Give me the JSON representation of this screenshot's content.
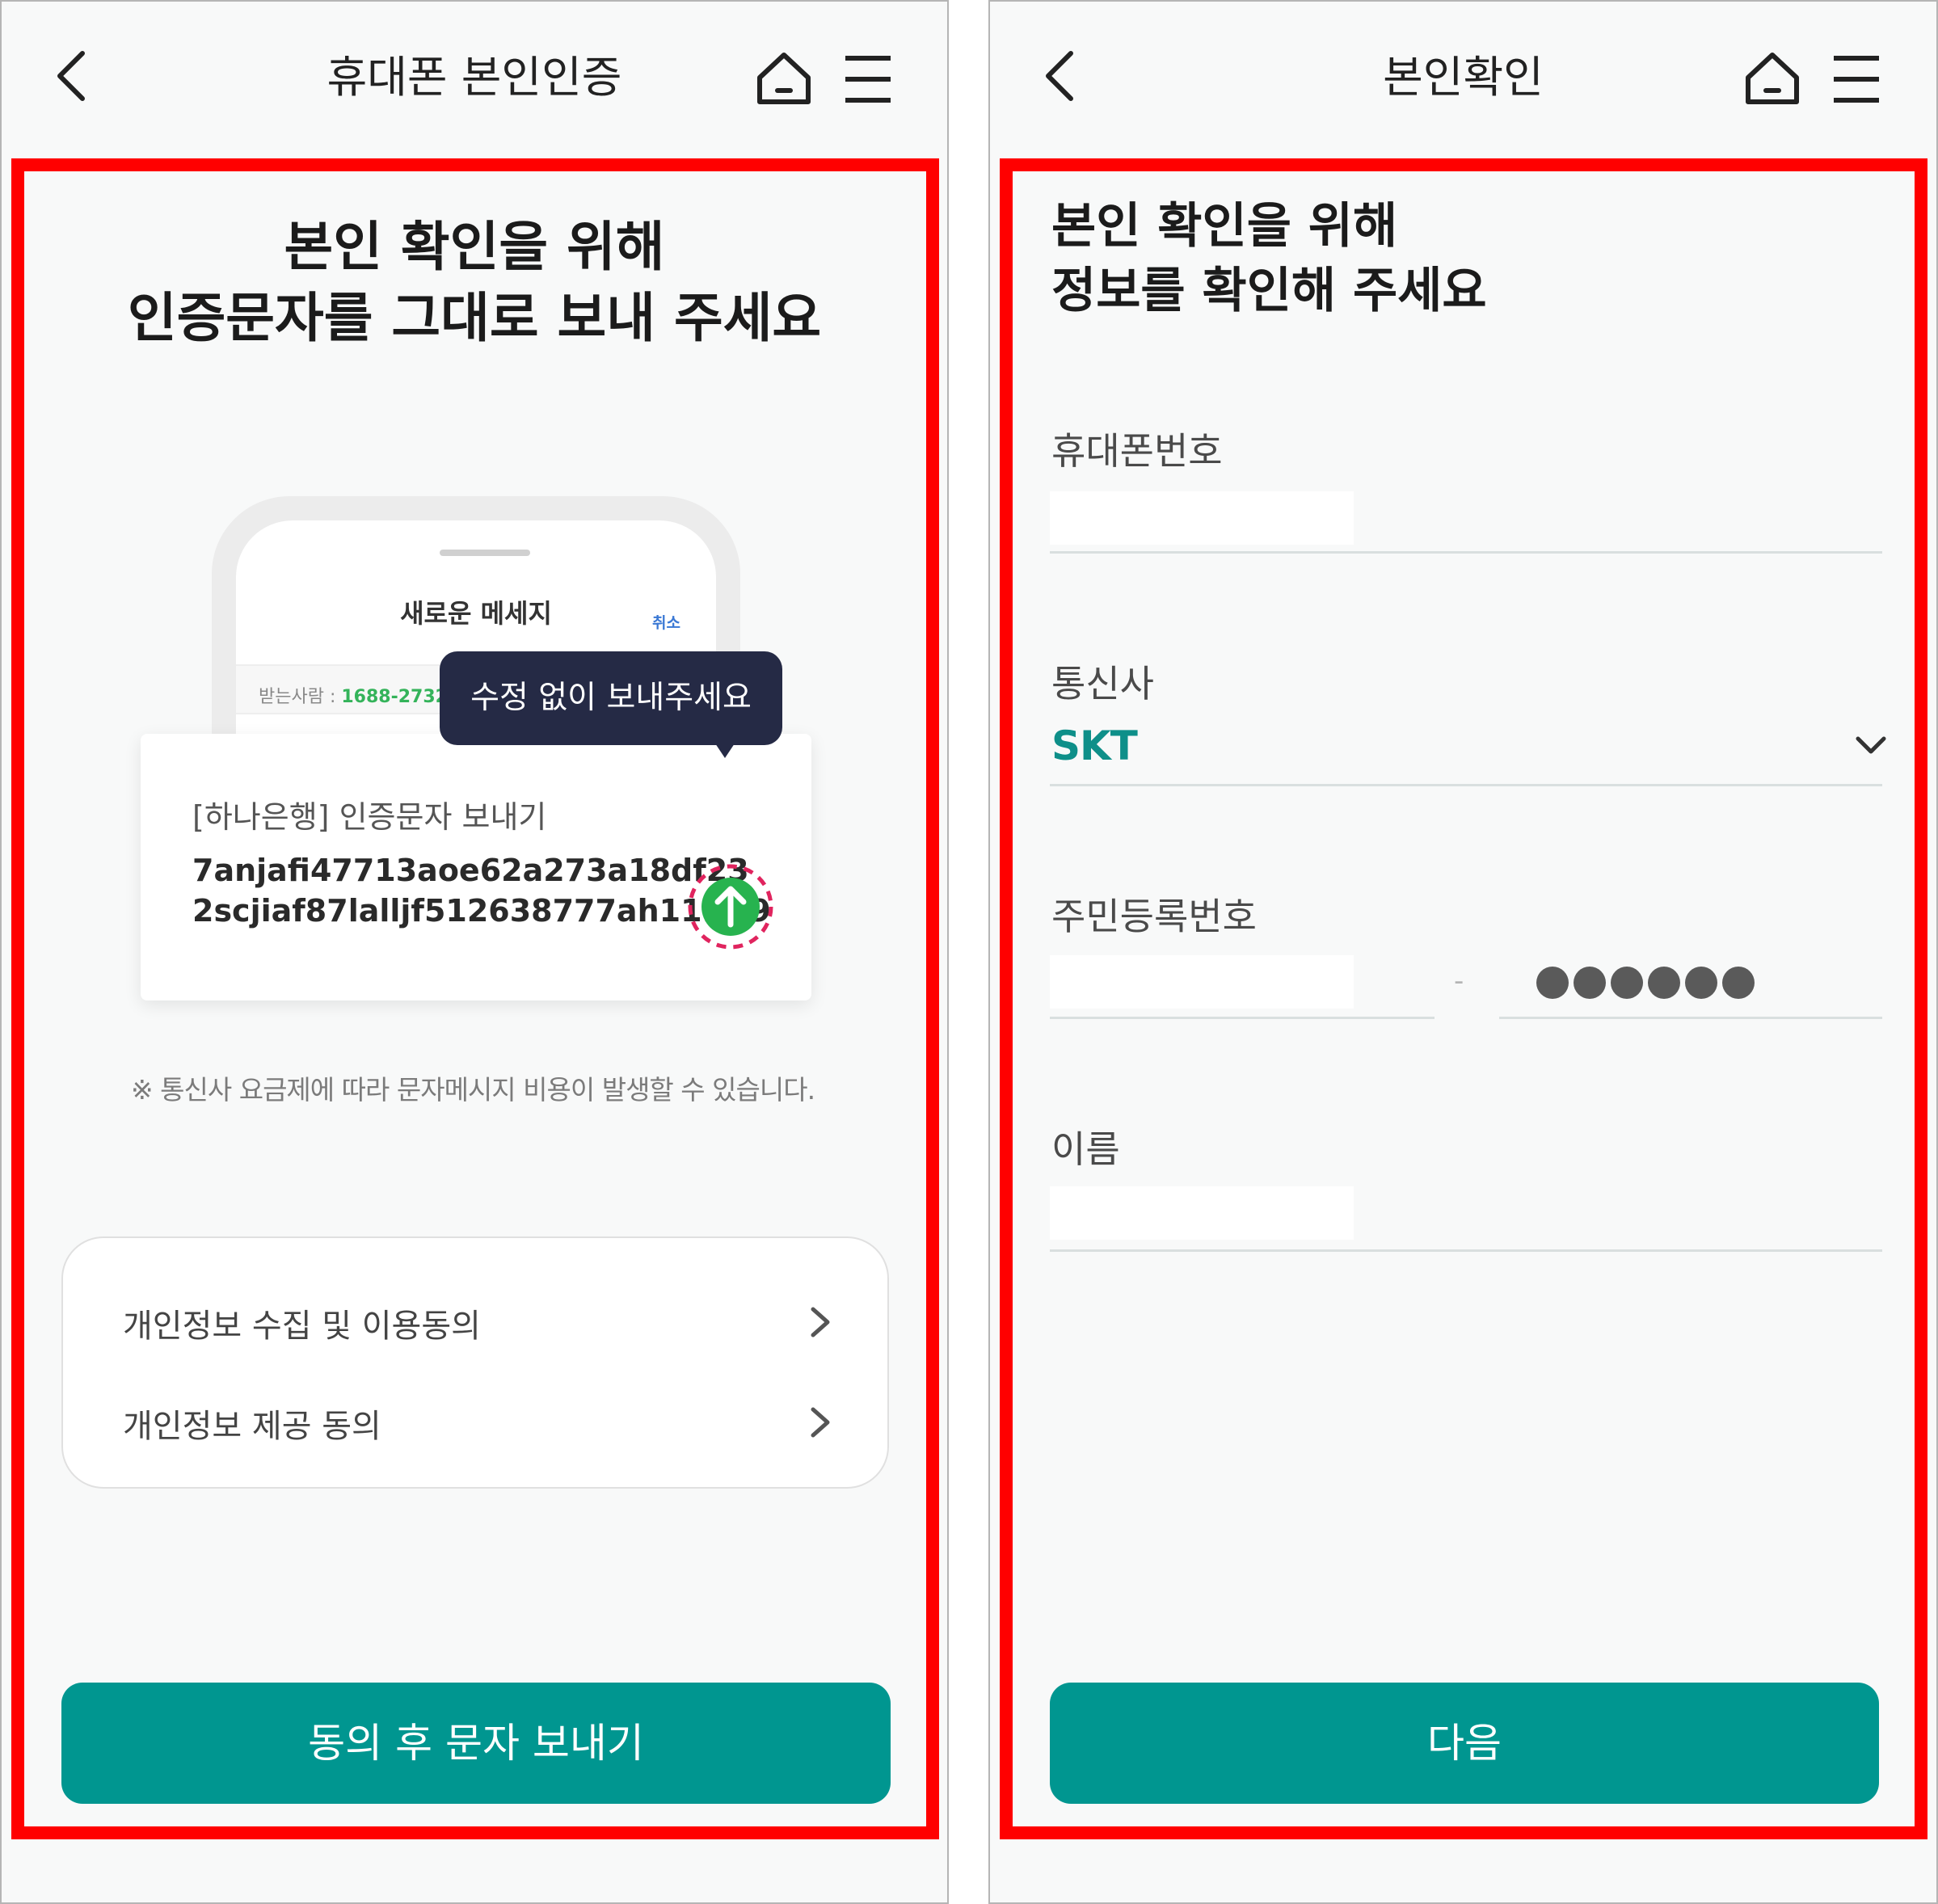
{
  "left_screen": {
    "header": {
      "title": "휴대폰 본인인증"
    },
    "heading": {
      "line1": "본인 확인을 위해",
      "line2": "인증문자를 그대로 보내 주세요"
    },
    "phone_mock": {
      "title": "새로운 메세지",
      "cancel": "취소",
      "recipient_label": "받는사람 : ",
      "recipient_number": "1688-2732"
    },
    "tooltip": "수정 없이 보내주세요",
    "message_card": {
      "label": "[하나은행] 인증문자 보내기",
      "code_line1": "7anjafi47713aoe62a273a18df23",
      "code_line2": "2scjiaf87lalljf512638777ah11fef9"
    },
    "note": "※  통신사 요금제에 따라 문자메시지 비용이 발생할 수 있습니다.",
    "agreements": [
      {
        "label": "개인정보 수집 및 이용동의"
      },
      {
        "label": "개인정보 제공 동의"
      }
    ],
    "submit_label": "동의 후 문자 보내기"
  },
  "right_screen": {
    "header": {
      "title": "본인확인"
    },
    "heading": {
      "line1": "본인 확인을 위해",
      "line2": "정보를 확인해 주세요"
    },
    "fields": {
      "phone_label": "휴대폰번호",
      "phone_value": "",
      "carrier_label": "통신사",
      "carrier_value": "SKT",
      "ssn_label": "주민등록번호",
      "ssn_front_value": "",
      "ssn_dash": "-",
      "ssn_back_masked_count": 6,
      "name_label": "이름",
      "name_value": ""
    },
    "next_label": "다음"
  },
  "colors": {
    "accent": "#009690",
    "carrier_text": "#0e8f89",
    "highlight_frame": "#ff0000",
    "tooltip_bg": "#252a45",
    "send_icon": "#27b34f",
    "send_ring": "#e0245e"
  },
  "icons": [
    "back-arrow-icon",
    "home-icon",
    "hamburger-menu-icon",
    "chevron-right-icon",
    "chevron-down-icon",
    "upload-arrow-icon"
  ]
}
